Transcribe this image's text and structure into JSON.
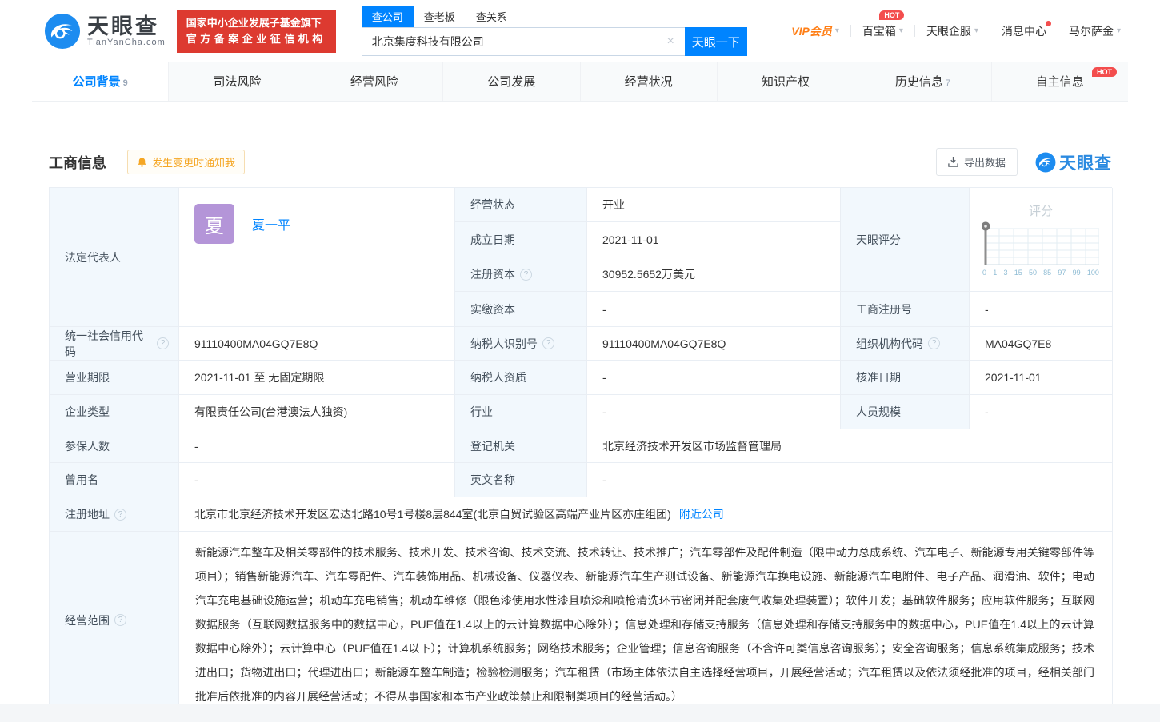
{
  "colors": {
    "accent": "#0084ff",
    "badge_red": "#dd3a30",
    "hot_red": "#f34d4d",
    "vip_orange": "#ff7e15",
    "notify_orange": "#f5a623",
    "label_bg": "#f2f8fd",
    "avatar_purple": "#b495d8"
  },
  "icons": {
    "help": "?",
    "close": "×",
    "caret_down": "▾",
    "logo": "tianyancha-eye",
    "bell": "bell",
    "download": "download-tray"
  },
  "header": {
    "logo": {
      "brand": "天眼查",
      "domain": "TianYanCha.com"
    },
    "badge": {
      "line1": "国家中小企业发展子基金旗下",
      "line2": "官方备案企业征信机构"
    },
    "search": {
      "tabs": [
        {
          "label": "查公司"
        },
        {
          "label": "查老板"
        },
        {
          "label": "查关系"
        }
      ],
      "input_value": "北京集度科技有限公司",
      "button": "天眼一下"
    },
    "menu": {
      "vip": "VIP会员",
      "toolbox": "百宝箱",
      "toolbox_hot": "HOT",
      "enterprise": "天眼企服",
      "messages": "消息中心",
      "user": "马尔萨金"
    }
  },
  "tabs": [
    {
      "label": "公司背景",
      "count": "9"
    },
    {
      "label": "司法风险",
      "count": ""
    },
    {
      "label": "经营风险",
      "count": ""
    },
    {
      "label": "公司发展",
      "count": ""
    },
    {
      "label": "经营状况",
      "count": ""
    },
    {
      "label": "知识产权",
      "count": ""
    },
    {
      "label": "历史信息",
      "count": "7"
    },
    {
      "label": "自主信息",
      "count": "",
      "hot": "HOT"
    }
  ],
  "section": {
    "title": "工商信息",
    "notify_button": "发生变更时通知我",
    "export_button": "导出数据",
    "watermark": "天眼查"
  },
  "table": {
    "legal_rep": {
      "label": "法定代表人",
      "avatar_char": "夏",
      "name": "夏一平"
    },
    "status": {
      "label": "经营状态",
      "value": "开业"
    },
    "est_date": {
      "label": "成立日期",
      "value": "2021-11-01"
    },
    "reg_capital": {
      "label": "注册资本",
      "value": "30952.5652万美元"
    },
    "paid_capital": {
      "label": "实缴资本",
      "value": "-"
    },
    "score": {
      "label": "天眼评分",
      "chart_title": "评分",
      "ticks": [
        "0",
        "1",
        "3",
        "15",
        "50",
        "85",
        "97",
        "99",
        "100"
      ],
      "marker_position": "0"
    },
    "reg_number": {
      "label": "工商注册号",
      "value": "-"
    },
    "credit_code": {
      "label": "统一社会信用代码",
      "value": "91110400MA04GQ7E8Q"
    },
    "taxpayer_id": {
      "label": "纳税人识别号",
      "value": "91110400MA04GQ7E8Q"
    },
    "org_code": {
      "label": "组织机构代码",
      "value": "MA04GQ7E8"
    },
    "business_term": {
      "label": "营业期限",
      "value": "2021-11-01 至 无固定期限"
    },
    "taxpayer_quality": {
      "label": "纳税人资质",
      "value": "-"
    },
    "approval_date": {
      "label": "核准日期",
      "value": "2021-11-01"
    },
    "company_type": {
      "label": "企业类型",
      "value": "有限责任公司(台港澳法人独资)"
    },
    "industry": {
      "label": "行业",
      "value": "-"
    },
    "staff_size": {
      "label": "人员规模",
      "value": "-"
    },
    "insured_count": {
      "label": "参保人数",
      "value": "-"
    },
    "reg_authority": {
      "label": "登记机关",
      "value": "北京经济技术开发区市场监督管理局"
    },
    "former_name": {
      "label": "曾用名",
      "value": "-"
    },
    "english_name": {
      "label": "英文名称",
      "value": "-"
    },
    "reg_address": {
      "label": "注册地址",
      "value": "北京市北京经济技术开发区宏达北路10号1号楼8层844室(北京自贸试验区高端产业片区亦庄组团)",
      "link": "附近公司"
    },
    "business_scope": {
      "label": "经营范围",
      "value": "新能源汽车整车及相关零部件的技术服务、技术开发、技术咨询、技术交流、技术转让、技术推广；汽车零部件及配件制造（限中动力总成系统、汽车电子、新能源专用关键零部件等项目）；销售新能源汽车、汽车零配件、汽车装饰用品、机械设备、仪器仪表、新能源汽车生产测试设备、新能源汽车换电设施、新能源汽车电附件、电子产品、润滑油、软件；电动汽车充电基础设施运营；机动车充电销售；机动车维修（限色漆使用水性漆且喷漆和喷枪清洗环节密闭并配套废气收集处理装置）；软件开发；基础软件服务；应用软件服务；互联网数据服务（互联网数据服务中的数据中心，PUE值在1.4以上的云计算数据中心除外）；信息处理和存储支持服务（信息处理和存储支持服务中的数据中心，PUE值在1.4以上的云计算数据中心除外）；云计算中心（PUE值在1.4以下）；计算机系统服务；网络技术服务；企业管理；信息咨询服务（不含许可类信息咨询服务）；安全咨询服务；信息系统集成服务；技术进出口；货物进出口；代理进出口；新能源车整车制造；检验检测服务；汽车租赁（市场主体依法自主选择经营项目，开展经营活动；汽车租赁以及依法须经批准的项目，经相关部门批准后依批准的内容开展经营活动；不得从事国家和本市产业政策禁止和限制类项目的经营活动。）"
    }
  }
}
